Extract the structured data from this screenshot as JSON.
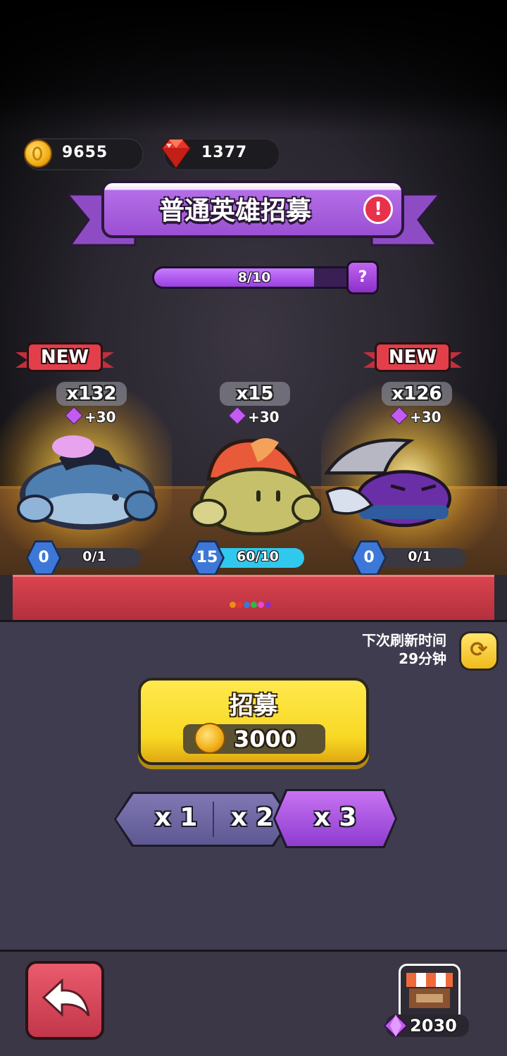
{
  "header": {
    "coins": "9655",
    "rubies": "1377"
  },
  "banner": {
    "title": "普通英雄招募",
    "alert_icon": "exclamation-icon"
  },
  "progress": {
    "label": "8/10",
    "fraction": 0.8,
    "help_label": "?"
  },
  "heroes": [
    {
      "new_label": "NEW",
      "count": "x132",
      "bonus": "+30",
      "level": "0",
      "progress": "0/1",
      "progress_fraction": 0,
      "color": "#4e7fb0"
    },
    {
      "new_label": "",
      "count": "x15",
      "bonus": "+30",
      "level": "15",
      "progress": "60/10",
      "progress_fraction": 1,
      "color": "#c7c06b"
    },
    {
      "new_label": "NEW",
      "count": "x126",
      "bonus": "+30",
      "level": "0",
      "progress": "0/1",
      "progress_fraction": 0,
      "color": "#6a2fa6"
    }
  ],
  "refresh": {
    "line1": "下次刷新时间",
    "line2": "29分钟",
    "icon": "refresh-icon"
  },
  "recruit": {
    "label": "招募",
    "cost": "3000"
  },
  "multipliers": [
    {
      "label": "x 1",
      "selected": false
    },
    {
      "label": "x 2",
      "selected": false
    },
    {
      "label": "x 3",
      "selected": true
    }
  ],
  "footer": {
    "back_icon": "back-arrow-icon",
    "shop_icon": "shop-icon",
    "gems": "2030"
  },
  "colors": {
    "accent_purple": "#9b4fd3",
    "coin_gold": "#f3b21c",
    "recruit_yellow": "#f8d824",
    "back_red": "#c33649"
  }
}
